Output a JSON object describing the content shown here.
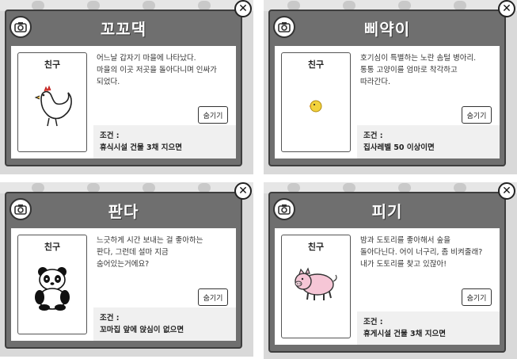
{
  "cards": [
    {
      "title": "꼬꼬댁",
      "card_label": "친구",
      "description": "어느날 갑자기 마을에 나타났다.\n마을의 이곳 저곳을 돌아다니며 인싸가\n되었다.",
      "hide_label": "숨기기",
      "condition_label": "조건 :",
      "condition_text": "휴식시설 건물 3채 지으면",
      "animal_icon": "chicken-icon"
    },
    {
      "title": "삐약이",
      "card_label": "친구",
      "description": "호기심이 특별하는 노란 솜털 병아리.\n통통 고양이를 엄마로 착각하고\n따라간다.",
      "hide_label": "숨기기",
      "condition_label": "조건 :",
      "condition_text": "집사레벨 50 이상이면",
      "animal_icon": "chick-icon"
    },
    {
      "title": "판다",
      "card_label": "친구",
      "description": "느긋하게 시간 보내는 걸 좋아하는\n판다, 그런데 설마 지금\n숨어있는거에요?",
      "hide_label": "숨기기",
      "condition_label": "조건 :",
      "condition_text": "꼬마집 앞에 앉심이 없으면",
      "animal_icon": "panda-icon"
    },
    {
      "title": "피기",
      "card_label": "친구",
      "description": "밤과 도토리를 좋아해서 숲을\n돌아다닌다. 어이 너구리, 좀 비켜줄래?\n내가 도토리를 찾고 있잖아!",
      "hide_label": "숨기기",
      "condition_label": "조건 :",
      "condition_text": "휴게시설 건물 3채 지으면",
      "animal_icon": "pig-icon"
    }
  ],
  "icons": {
    "close": "✕",
    "camera": "camera-icon"
  },
  "colors": {
    "dialog": "#6f6f6f",
    "chick": "#f2d23c",
    "pig": "#f6c6d6"
  }
}
